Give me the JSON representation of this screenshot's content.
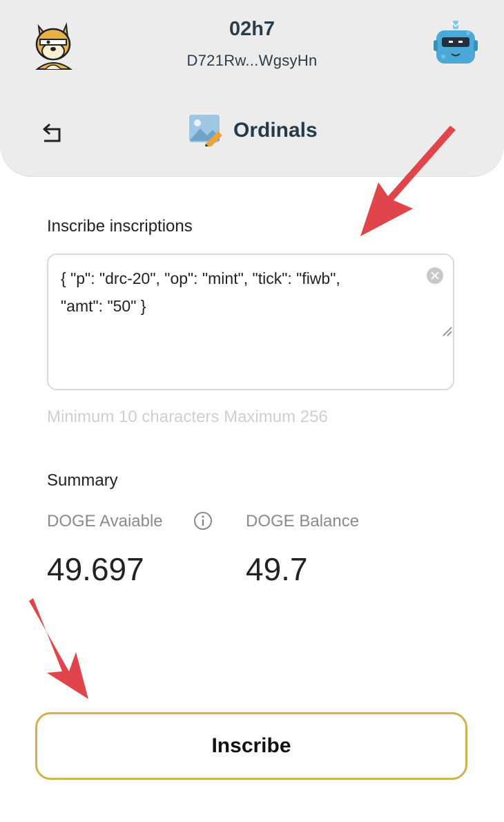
{
  "header": {
    "wallet_name": "02h7",
    "wallet_address": "D721Rw...WgsyHn",
    "page_title": "Ordinals"
  },
  "inscribe": {
    "label": "Inscribe inscriptions",
    "value_line1": "{ \"p\": \"drc-20\", \"op\": \"mint\", \"tick\": \"fiwb\",",
    "value_line2": "\"amt\": \"50\" }",
    "hint": "Minimum 10 characters Maximum 256"
  },
  "summary": {
    "title": "Summary",
    "available_label": "DOGE Avaiable",
    "available_value": "49.697",
    "balance_label": "DOGE Balance",
    "balance_value": "49.7"
  },
  "actions": {
    "inscribe_button": "Inscribe"
  },
  "colors": {
    "header_bg": "#ececec",
    "title_text": "#24394a",
    "button_border": "#d2b04a",
    "annotation_arrow": "#e0454b"
  }
}
